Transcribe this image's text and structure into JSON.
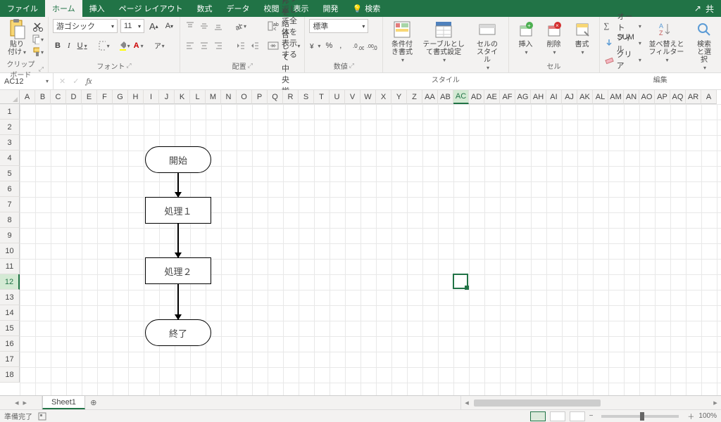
{
  "tabs": {
    "file": "ファイル",
    "home": "ホーム",
    "insert": "挿入",
    "pagelayout": "ページ レイアウト",
    "formulas": "数式",
    "data": "データ",
    "review": "校閲",
    "view": "表示",
    "developer": "開発",
    "search": "検索"
  },
  "titleright": {
    "share": "共"
  },
  "clipboard": {
    "paste": "貼り付け",
    "label": "クリップボード"
  },
  "font": {
    "name": "游ゴシック",
    "size": "11",
    "label": "フォント",
    "bold": "B",
    "italic": "I",
    "underline": "U",
    "inc": "A",
    "dec": "A"
  },
  "alignment": {
    "wrap": "折り返して全体を表示する",
    "merge": "セルを結合して中央揃え",
    "label": "配置"
  },
  "numbergrp": {
    "general": "標準",
    "label": "数値"
  },
  "styles": {
    "cond": "条件付き書式",
    "tbl": "テーブルとして書式設定",
    "cell": "セルのスタイル",
    "label": "スタイル"
  },
  "cellsgrp": {
    "insert": "挿入",
    "delete": "削除",
    "format": "書式",
    "label": "セル"
  },
  "editing": {
    "autosum": "オート SUM",
    "fill": "フィル",
    "clear": "クリア",
    "sort": "並べ替えとフィルター",
    "find": "検索と選択",
    "label": "編集"
  },
  "namebox": "AC12",
  "columns": [
    "A",
    "B",
    "C",
    "D",
    "E",
    "F",
    "G",
    "H",
    "I",
    "J",
    "K",
    "L",
    "M",
    "N",
    "O",
    "P",
    "Q",
    "R",
    "S",
    "T",
    "U",
    "V",
    "W",
    "X",
    "Y",
    "Z",
    "AA",
    "AB",
    "AC",
    "AD",
    "AE",
    "AF",
    "AG",
    "AH",
    "AI",
    "AJ",
    "AK",
    "AL",
    "AM",
    "AN",
    "AO",
    "AP",
    "AQ",
    "AR",
    "A"
  ],
  "rows": [
    "1",
    "2",
    "3",
    "4",
    "5",
    "6",
    "7",
    "8",
    "9",
    "10",
    "11",
    "12",
    "13",
    "14",
    "15",
    "16",
    "17",
    "18"
  ],
  "selected": {
    "col": 28,
    "row": 11
  },
  "flow": {
    "start": "開始",
    "p1": "処理１",
    "p2": "処理２",
    "end": "終了"
  },
  "sheet": {
    "name": "Sheet1"
  },
  "status": {
    "ready": "準備完了",
    "zoom": "100%"
  },
  "percent": "%"
}
